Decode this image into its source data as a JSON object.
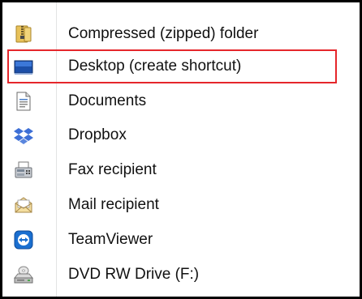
{
  "menu": {
    "items": [
      {
        "label": "Compressed (zipped) folder",
        "icon": "zip-folder-icon"
      },
      {
        "label": "Desktop (create shortcut)",
        "icon": "desktop-icon",
        "highlighted": true
      },
      {
        "label": "Documents",
        "icon": "documents-icon"
      },
      {
        "label": "Dropbox",
        "icon": "dropbox-icon"
      },
      {
        "label": "Fax recipient",
        "icon": "fax-icon"
      },
      {
        "label": "Mail recipient",
        "icon": "mail-icon"
      },
      {
        "label": "TeamViewer",
        "icon": "teamviewer-icon"
      },
      {
        "label": "DVD RW Drive (F:)",
        "icon": "dvd-drive-icon"
      }
    ]
  },
  "colors": {
    "highlight_border": "#e5262b",
    "border": "#000000",
    "gutter_line": "#e2e3e3"
  }
}
